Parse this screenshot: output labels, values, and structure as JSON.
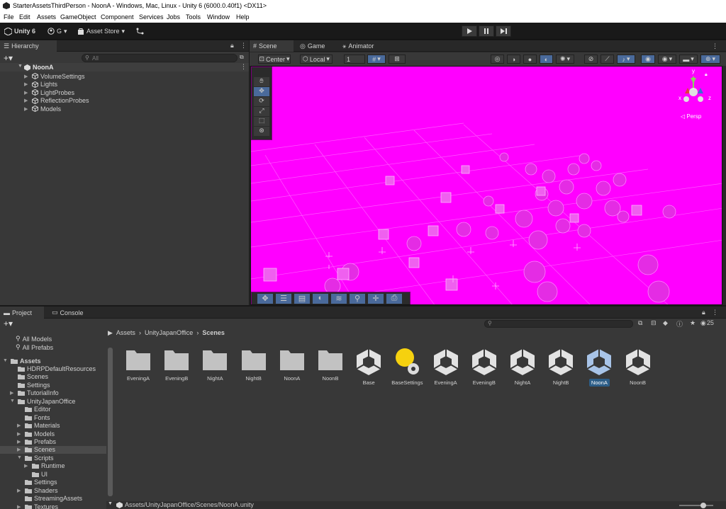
{
  "window": {
    "title": "StarterAssetsThirdPerson - NoonA - Windows, Mac, Linux - Unity 6 (6000.0.40f1) <DX11>"
  },
  "menu": [
    "File",
    "Edit",
    "Assets",
    "GameObject",
    "Component",
    "Services",
    "Jobs",
    "Tools",
    "Window",
    "Help"
  ],
  "toolbar": {
    "unity_label": "Unity 6",
    "account_label": "G",
    "asset_store_label": "Asset Store"
  },
  "hierarchy": {
    "tab_label": "Hierarchy",
    "search_placeholder": "All",
    "scene_name": "NoonA",
    "items": [
      "VolumeSettings",
      "Lights",
      "LightProbes",
      "ReflectionProbes",
      "Models"
    ]
  },
  "scene_tabs": [
    "Scene",
    "Game",
    "Animator"
  ],
  "scene_toolbar": {
    "pivot": "Center",
    "space": "Local",
    "grid_value": "1"
  },
  "scene": {
    "camera_mode": "◁ Persp",
    "axis_x": "x",
    "axis_y": "y",
    "axis_z": "z"
  },
  "project": {
    "tabs": [
      "Project",
      "Console"
    ],
    "visible_count": "25",
    "favorites": [
      "All Models",
      "All Prefabs"
    ],
    "tree": [
      {
        "label": "Assets",
        "indent": 0,
        "arrow": "▼",
        "bold": true
      },
      {
        "label": "HDRPDefaultResources",
        "indent": 1,
        "arrow": ""
      },
      {
        "label": "Scenes",
        "indent": 1,
        "arrow": ""
      },
      {
        "label": "Settings",
        "indent": 1,
        "arrow": ""
      },
      {
        "label": "TutorialInfo",
        "indent": 1,
        "arrow": "▶"
      },
      {
        "label": "UnityJapanOffice",
        "indent": 1,
        "arrow": "▼"
      },
      {
        "label": "Editor",
        "indent": 2,
        "arrow": ""
      },
      {
        "label": "Fonts",
        "indent": 2,
        "arrow": ""
      },
      {
        "label": "Materials",
        "indent": 2,
        "arrow": "▶"
      },
      {
        "label": "Models",
        "indent": 2,
        "arrow": "▶"
      },
      {
        "label": "Prefabs",
        "indent": 2,
        "arrow": "▶"
      },
      {
        "label": "Scenes",
        "indent": 2,
        "arrow": "▶",
        "selected": true
      },
      {
        "label": "Scripts",
        "indent": 2,
        "arrow": "▼"
      },
      {
        "label": "Runtime",
        "indent": 3,
        "arrow": "▶"
      },
      {
        "label": "UI",
        "indent": 3,
        "arrow": ""
      },
      {
        "label": "Settings",
        "indent": 2,
        "arrow": ""
      },
      {
        "label": "Shaders",
        "indent": 2,
        "arrow": "▶"
      },
      {
        "label": "StreamingAssets",
        "indent": 2,
        "arrow": ""
      },
      {
        "label": "Textures",
        "indent": 2,
        "arrow": "▶"
      }
    ],
    "breadcrumb": [
      "Assets",
      "UnityJapanOffice",
      "Scenes"
    ],
    "assets": [
      {
        "name": "EveningA",
        "kind": "folder"
      },
      {
        "name": "EveningB",
        "kind": "folder"
      },
      {
        "name": "NightA",
        "kind": "folder"
      },
      {
        "name": "NightB",
        "kind": "folder"
      },
      {
        "name": "NoonA",
        "kind": "folder"
      },
      {
        "name": "NoonB",
        "kind": "folder"
      },
      {
        "name": "Base",
        "kind": "scene"
      },
      {
        "name": "BaseSettings",
        "kind": "lighting"
      },
      {
        "name": "EveningA",
        "kind": "scene"
      },
      {
        "name": "EveningB",
        "kind": "scene"
      },
      {
        "name": "NightA",
        "kind": "scene"
      },
      {
        "name": "NightB",
        "kind": "scene"
      },
      {
        "name": "NoonA",
        "kind": "scene",
        "selected": true
      },
      {
        "name": "NoonB",
        "kind": "scene"
      }
    ],
    "status_path": "Assets/UnityJapanOffice/Scenes/NoonA.unity"
  },
  "colors": {
    "scene_bg": "#ff00ff",
    "selection": "#2c5d87",
    "lighting_icon": "#f5d10f"
  }
}
